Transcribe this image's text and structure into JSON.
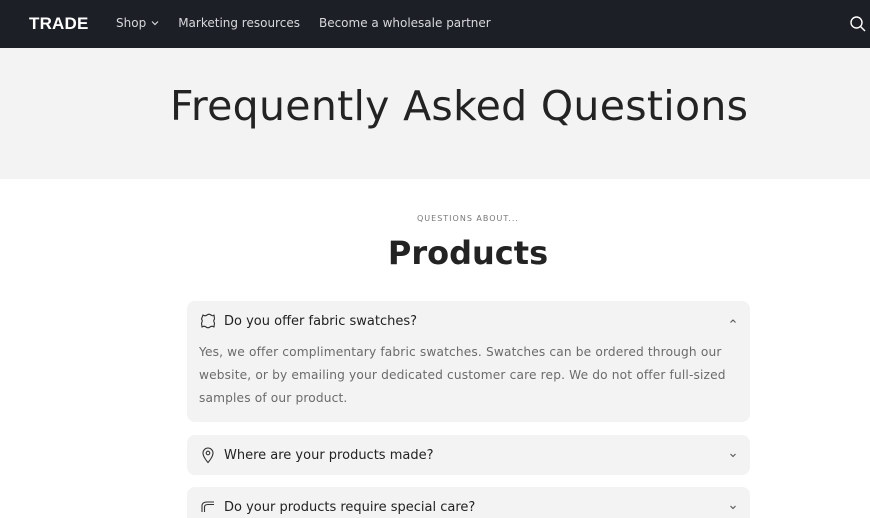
{
  "header": {
    "logo": "TRADE",
    "nav": [
      {
        "label": "Shop",
        "has_dropdown": true
      },
      {
        "label": "Marketing resources",
        "has_dropdown": false
      },
      {
        "label": "Become a wholesale partner",
        "has_dropdown": false
      }
    ],
    "search_icon": "search-icon"
  },
  "hero": {
    "title": "Frequently Asked Questions"
  },
  "section": {
    "eyebrow": "QUESTIONS ABOUT...",
    "title": "Products"
  },
  "faqs": [
    {
      "icon": "fabric-swatch-icon",
      "question": "Do you offer fabric swatches?",
      "expanded": true,
      "answer_lines": [
        "Yes, we offer complimentary fabric swatches. Swatches can be ordered through our",
        "website, or by emailing your dedicated customer care rep. We do not offer full-sized",
        "samples of our product."
      ]
    },
    {
      "icon": "location-pin-icon",
      "question": "Where are your products made?",
      "expanded": false
    },
    {
      "icon": "care-tag-icon",
      "question": "Do your products require special care?",
      "expanded": false
    }
  ],
  "colors": {
    "topbar": "#1c1f26",
    "hero_bg": "#f3f3f3",
    "card_bg": "#f3f3f3",
    "text": "#232323",
    "muted_text": "#6b6b6b"
  }
}
